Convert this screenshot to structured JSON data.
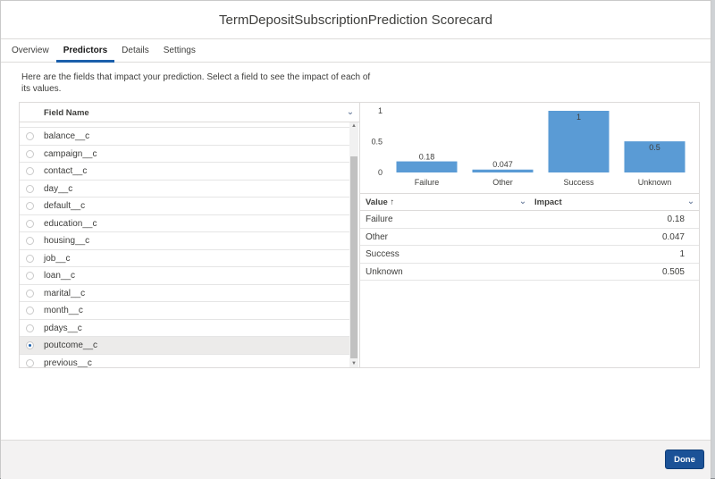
{
  "modal": {
    "title": "TermDepositSubscriptionPrediction Scorecard"
  },
  "tabs": [
    {
      "label": "Overview",
      "active": false
    },
    {
      "label": "Predictors",
      "active": true
    },
    {
      "label": "Details",
      "active": false
    },
    {
      "label": "Settings",
      "active": false
    }
  ],
  "intro": "Here are the fields that impact your prediction. Select a field to see the impact of each of its values.",
  "field_list": {
    "header": "Field Name",
    "items": [
      {
        "label": "balance__c",
        "selected": false
      },
      {
        "label": "campaign__c",
        "selected": false
      },
      {
        "label": "contact__c",
        "selected": false
      },
      {
        "label": "day__c",
        "selected": false
      },
      {
        "label": "default__c",
        "selected": false
      },
      {
        "label": "education__c",
        "selected": false
      },
      {
        "label": "housing__c",
        "selected": false
      },
      {
        "label": "job__c",
        "selected": false
      },
      {
        "label": "loan__c",
        "selected": false
      },
      {
        "label": "marital__c",
        "selected": false
      },
      {
        "label": "month__c",
        "selected": false
      },
      {
        "label": "pdays__c",
        "selected": false
      },
      {
        "label": "poutcome__c",
        "selected": true
      },
      {
        "label": "previous__c",
        "selected": false
      }
    ]
  },
  "chart_data": {
    "type": "bar",
    "categories": [
      "Failure",
      "Other",
      "Success",
      "Unknown"
    ],
    "values": [
      0.18,
      0.047,
      1,
      0.505
    ],
    "data_labels": [
      "0.18",
      "0.047",
      "1",
      "0.5"
    ],
    "y_ticks": [
      "0",
      "0.5",
      "1"
    ],
    "ylim": [
      0,
      1
    ],
    "bar_color": "#5a9bd5",
    "grid": false
  },
  "impact_table": {
    "col_value": "Value",
    "col_impact": "Impact",
    "sort_arrow": "↑",
    "rows": [
      {
        "value": "Failure",
        "impact": "0.18"
      },
      {
        "value": "Other",
        "impact": "0.047"
      },
      {
        "value": "Success",
        "impact": "1"
      },
      {
        "value": "Unknown",
        "impact": "0.505"
      }
    ]
  },
  "footer": {
    "done_label": "Done"
  },
  "colors": {
    "accent": "#1b5297",
    "tab_underline": "#1b5fab"
  }
}
